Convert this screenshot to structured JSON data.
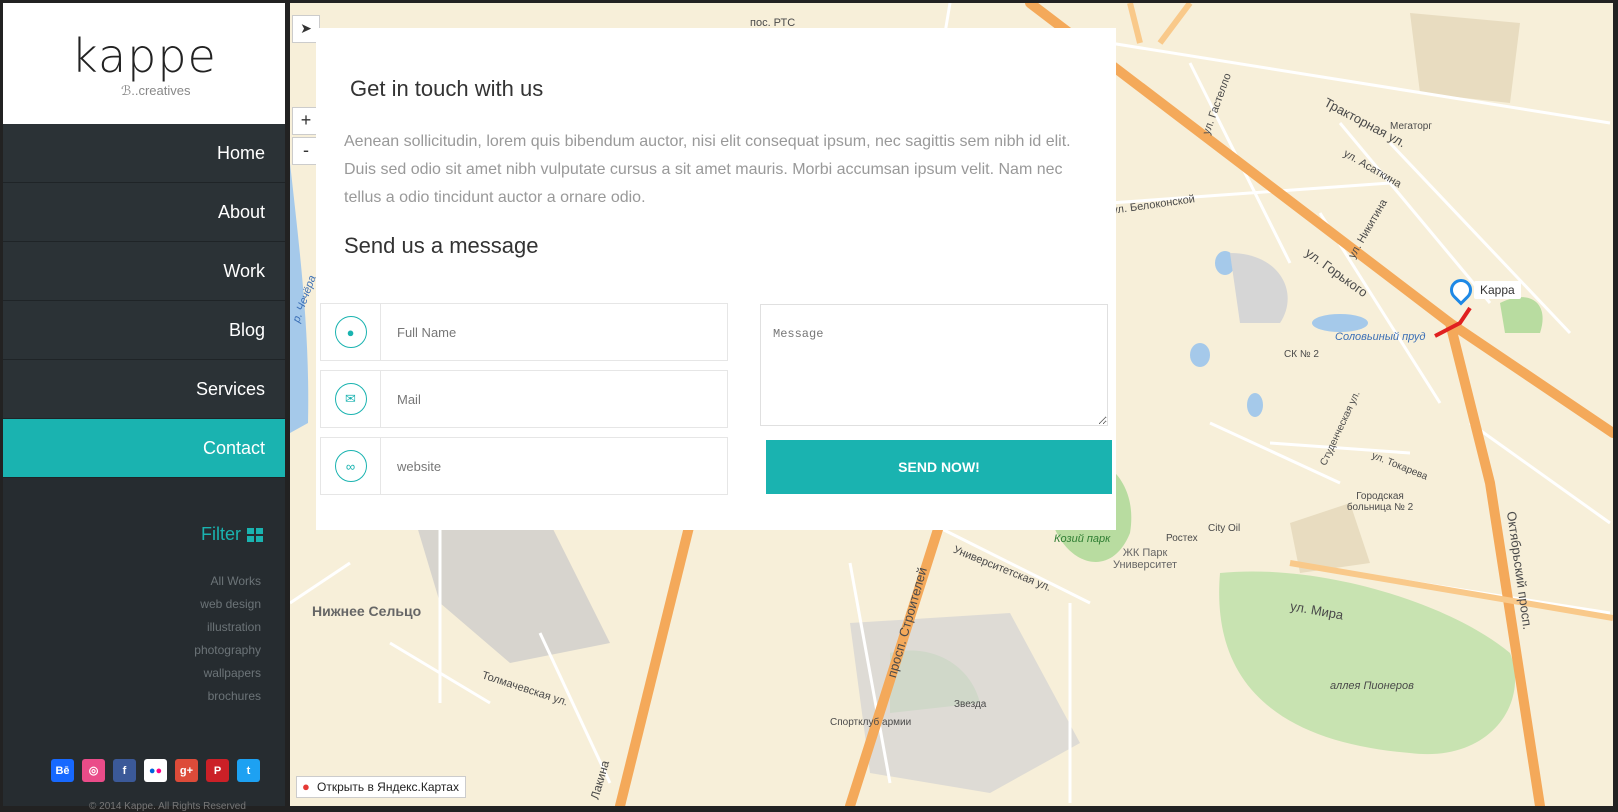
{
  "logo": {
    "name": "kappe",
    "tagline": "creatives"
  },
  "nav": [
    {
      "label": "Home",
      "active": false
    },
    {
      "label": "About",
      "active": false
    },
    {
      "label": "Work",
      "active": false
    },
    {
      "label": "Blog",
      "active": false
    },
    {
      "label": "Services",
      "active": false
    },
    {
      "label": "Contact",
      "active": true
    }
  ],
  "filter": {
    "title": "Filter",
    "items": [
      "All Works",
      "web design",
      "illustration",
      "photography",
      "wallpapers",
      "brochures"
    ]
  },
  "social": [
    "behance-icon",
    "dribbble-icon",
    "facebook-icon",
    "flickr-icon",
    "google-plus-icon",
    "pinterest-icon",
    "twitter-icon"
  ],
  "footer": {
    "copyright": "© 2014 Kappe. All Rights Reserved"
  },
  "contact": {
    "title": "Get in touch with us",
    "description": "Aenean sollicitudin, lorem quis bibendum auctor, nisi elit consequat ipsum, nec sagittis sem nibh id elit. Duis sed odio sit amet nibh vulputate cursus a sit amet mauris. Morbi accumsan ipsum velit. Nam nec tellus a odio tincidunt auctor a ornare odio.",
    "subtitle": "Send us a message",
    "fields": [
      {
        "placeholder": "Full Name",
        "icon": "user-icon"
      },
      {
        "placeholder": "Mail",
        "icon": "envelope-icon"
      },
      {
        "placeholder": "website",
        "icon": "link-icon"
      }
    ],
    "message_placeholder": "Message",
    "send_label": "SEND NOW!"
  },
  "map": {
    "open_link": "Открыть в Яндекс.Картах",
    "marker_label": "Kappa",
    "zoom_in": "+",
    "zoom_out": "-",
    "labels": [
      {
        "text": "пос. РТС"
      },
      {
        "text": "ул. Горького"
      },
      {
        "text": "Тракторная ул."
      },
      {
        "text": "ул. Асаткина"
      },
      {
        "text": "ул. Никитина"
      },
      {
        "text": "ул. Белоконской"
      },
      {
        "text": "ул. Гастелло"
      },
      {
        "text": "Мегаторг"
      },
      {
        "text": "Соловьиный пруд"
      },
      {
        "text": "СК № 2"
      },
      {
        "text": "Студенческая ул."
      },
      {
        "text": "ул. Токарева"
      },
      {
        "text": "Городская больница № 2"
      },
      {
        "text": "Октябрьский просп."
      },
      {
        "text": "ул. Мира"
      },
      {
        "text": "аллея Пионеров"
      },
      {
        "text": "Козий парк"
      },
      {
        "text": "Ростех"
      },
      {
        "text": "City Oil"
      },
      {
        "text": "ЖК Парк Университет"
      },
      {
        "text": "Университетская ул."
      },
      {
        "text": "Нижнее Сельцо"
      },
      {
        "text": "Толмачевская ул."
      },
      {
        "text": "просп. Строителей"
      },
      {
        "text": "Спортклуб армии"
      },
      {
        "text": "Звезда"
      },
      {
        "text": "Лакина"
      },
      {
        "text": "р. Чечёра"
      }
    ]
  },
  "colors": {
    "accent": "#1ab3b0",
    "sidebar": "#262c30",
    "map_bg": "#f7efd9",
    "road": "#f4a95a"
  }
}
